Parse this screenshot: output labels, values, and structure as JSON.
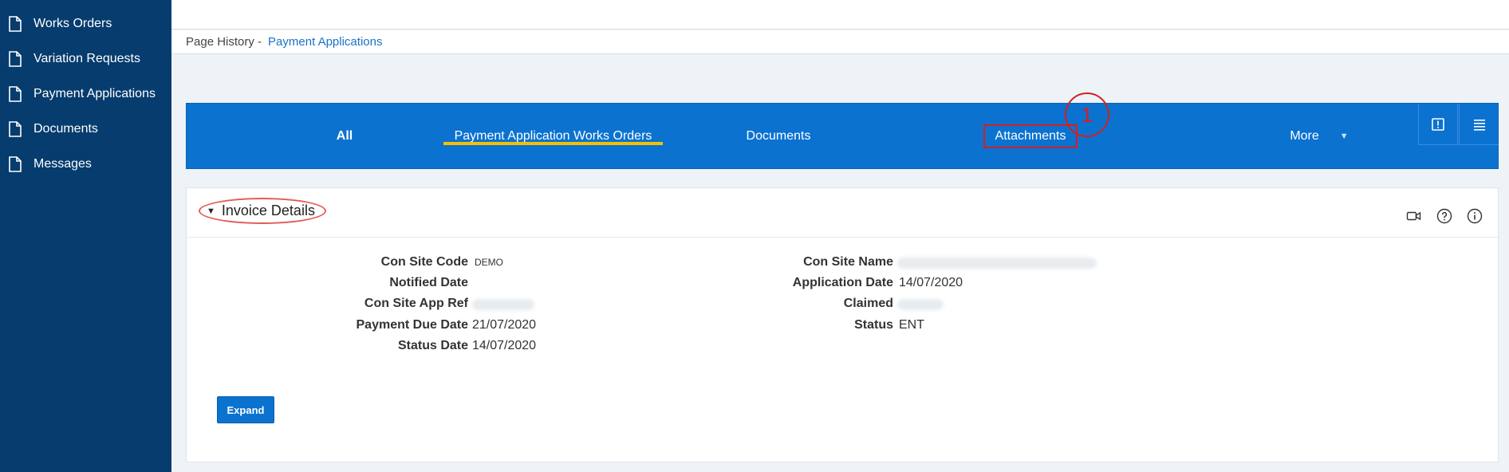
{
  "sidebar": {
    "items": [
      {
        "label": "Works Orders",
        "icon": "document-icon"
      },
      {
        "label": "Variation Requests",
        "icon": "document-icon"
      },
      {
        "label": "Payment Applications",
        "icon": "document-icon"
      },
      {
        "label": "Documents",
        "icon": "document-icon"
      },
      {
        "label": "Messages",
        "icon": "document-icon"
      }
    ]
  },
  "breadcrumb": {
    "label": "Page History -",
    "link": "Payment Applications"
  },
  "tabs": {
    "all": "All",
    "payment_application_works_orders": "Payment Application Works Orders",
    "documents": "Documents",
    "attachments": "Attachments",
    "more": "More"
  },
  "annotation": {
    "number": "1",
    "color": "#d61f1f"
  },
  "region": {
    "title": "Invoice Details",
    "expand_label": "Expand",
    "fields": {
      "con_site_code_label": "Con Site Code",
      "con_site_code_value": "DEMO",
      "notified_date_label": "Notified Date",
      "con_site_app_ref_label": "Con Site App Ref",
      "payment_due_date_label": "Payment Due Date",
      "payment_due_date_value": "21/07/2020",
      "status_date_label": "Status Date",
      "status_date_value": "14/07/2020",
      "con_site_name_label": "Con Site Name",
      "application_date_label": "Application Date",
      "application_date_value": "14/07/2020",
      "claimed_label": "Claimed",
      "status_label": "Status",
      "status_value": "ENT"
    }
  },
  "colors": {
    "sidebar_bg": "#063c6e",
    "tabbar_bg": "#0b72d0",
    "active_tab_underline": "#f2c200",
    "link": "#1a73c7"
  }
}
